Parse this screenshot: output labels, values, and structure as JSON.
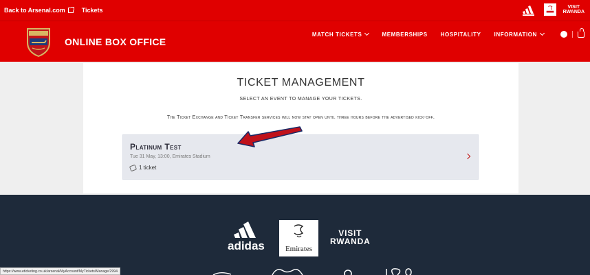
{
  "topbar": {
    "back_link": "Back to Arsenal.com",
    "tickets_link": "Tickets",
    "visit_rwanda": [
      "VISIT",
      "RWANDA"
    ]
  },
  "header": {
    "brand": "ONLINE BOX OFFICE",
    "nav": [
      {
        "label": "MATCH TICKETS",
        "has_dropdown": true
      },
      {
        "label": "MEMBERSHIPS",
        "has_dropdown": false
      },
      {
        "label": "HOSPITALITY",
        "has_dropdown": false
      },
      {
        "label": "INFORMATION",
        "has_dropdown": true
      }
    ]
  },
  "main": {
    "title": "TICKET MANAGEMENT",
    "subtitle": "Select an event to manage your tickets.",
    "notice": "The Ticket Exchange and Ticket Transfer services will now stay open until three hours before the advertised kick-off.",
    "event": {
      "name": "Platinum Test",
      "meta": "Tue 31 May, 13:00, Emirates Stadium",
      "tickets": "1 ticket"
    }
  },
  "footer": {
    "adidas": "adidas",
    "emirates": "Emirates",
    "visit_rwanda": [
      "VISIT",
      "RWANDA"
    ]
  },
  "status_url": "https://www.eticketing.co.uk/arsenal/MyAccount/MyTickets/Manage/2994",
  "colors": {
    "brand_red": "#e00000",
    "footer_navy": "#1e2a3a",
    "event_bg": "#e6e8ee",
    "arrow_red": "#c0111a"
  }
}
